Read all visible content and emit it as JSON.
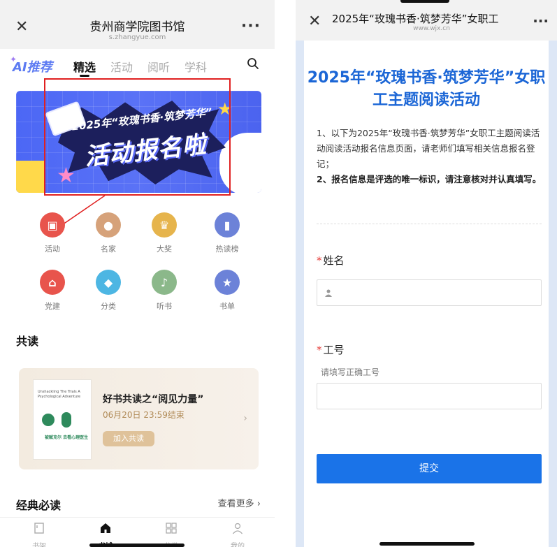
{
  "left": {
    "title": "贵州商学院图书馆",
    "url": "s.zhangyue.com",
    "more_glyph": "···",
    "tabs": [
      {
        "label": "AI推荐"
      },
      {
        "label": "精选",
        "active": true
      },
      {
        "label": "活动"
      },
      {
        "label": "阅听"
      },
      {
        "label": "学科"
      }
    ],
    "banner": {
      "subtitle": "2025年“玫瑰书香·筑梦芳华”",
      "headline": "活动报名啦"
    },
    "icons": [
      {
        "label": "活动",
        "color": "#e8544c",
        "glyph": "▣"
      },
      {
        "label": "名家",
        "color": "#d6a27a",
        "glyph": "●"
      },
      {
        "label": "大奖",
        "color": "#e6b44c",
        "glyph": "♛"
      },
      {
        "label": "热读榜",
        "color": "#6c82d8",
        "glyph": "▮"
      },
      {
        "label": "党建",
        "color": "#e8544c",
        "glyph": "⌂"
      },
      {
        "label": "分类",
        "color": "#4db6e3",
        "glyph": "◆"
      },
      {
        "label": "听书",
        "color": "#8bb88a",
        "glyph": "♪"
      },
      {
        "label": "书单",
        "color": "#6c82d8",
        "glyph": "★"
      }
    ],
    "gongdu_title": "共读",
    "card": {
      "title": "好书共读之“阅见力量”",
      "time": "06月20日 23:59结束",
      "button": "加入共读",
      "cover_text_en": "Unshackling The Trials A Psychological Adventure",
      "cover_text_cn": "被赋克尔 去看心理医生"
    },
    "classic_title": "经典必读",
    "see_more": "查看更多",
    "nav": [
      {
        "label": "书架"
      },
      {
        "label": "书城",
        "active": true
      },
      {
        "label": "分类"
      },
      {
        "label": "我的"
      }
    ]
  },
  "right": {
    "title": "2025年“玫瑰书香·筑梦芳华”女职工",
    "url": "www.wjx.cn",
    "more_glyph": "···",
    "form_title": "2025年“玫瑰书香·筑梦芳华”女职工主题阅读活动",
    "desc1": "1、以下为2025年“玫瑰书香·筑梦芳华”女职工主题阅读活动阅读活动报名信息页面，请老师们填写相关信息报名登记；",
    "desc2": "2、报名信息是评选的唯一标识，请注意核对并认真填写。",
    "fields": [
      {
        "label": "姓名",
        "required": true,
        "hint": ""
      },
      {
        "label": "工号",
        "required": true,
        "hint": "请填写正确工号"
      }
    ],
    "submit": "提交",
    "required_mark": "*"
  }
}
